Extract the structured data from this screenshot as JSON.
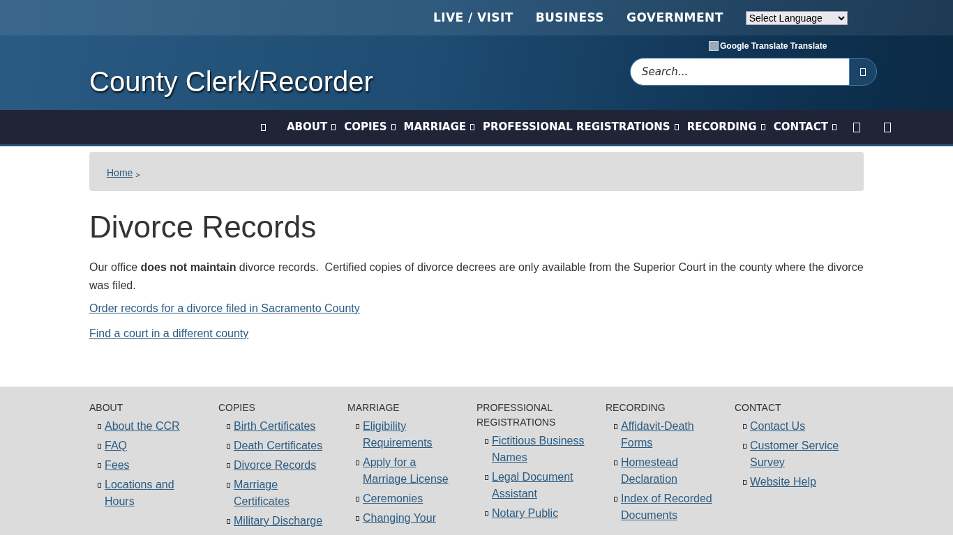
{
  "top_links": [
    "LIVE / VISIT",
    "BUSINESS",
    "GOVERNMENT"
  ],
  "language_select": {
    "value": "Select Language"
  },
  "translate": {
    "text": "Google Translate Translate"
  },
  "site_title": "County Clerk/Recorder",
  "search": {
    "placeholder": "Search..."
  },
  "nav": [
    "ABOUT",
    "COPIES",
    "MARRIAGE",
    "PROFESSIONAL REGISTRATIONS",
    "RECORDING",
    "CONTACT"
  ],
  "breadcrumb": {
    "items": [
      "Home"
    ],
    "separator": ">"
  },
  "page_title": "Divorce Records",
  "intro": "Our office **does not maintain** divorce records.  Certified copies of divorce decrees are only available from the Superior Court in the county where the divorce was filed.",
  "links": [
    "Order records for a divorce filed in Sacramento County",
    "Find a court in a different county"
  ],
  "footer": [
    {
      "heading": "ABOUT",
      "items": [
        "About the CCR",
        "FAQ",
        "Fees",
        "Locations and Hours"
      ]
    },
    {
      "heading": "COPIES",
      "items": [
        "Birth Certificates",
        "Death Certificates",
        "Divorce Records",
        "Marriage Certificates",
        "Military Discharge"
      ]
    },
    {
      "heading": "MARRIAGE",
      "items": [
        "Eligibility Requirements",
        "Apply for a Marriage License",
        "Ceremonies",
        "Changing Your"
      ]
    },
    {
      "heading": "PROFESSIONAL REGISTRATIONS",
      "items": [
        "Fictitious Business Names",
        "Legal Document Assistant",
        "Notary Public"
      ]
    },
    {
      "heading": "RECORDING",
      "items": [
        "Affidavit-Death Forms",
        "Homestead Declaration",
        "Index of Recorded Documents"
      ]
    },
    {
      "heading": "CONTACT",
      "items": [
        "Contact Us",
        "Customer Service Survey",
        "Website Help"
      ]
    }
  ]
}
